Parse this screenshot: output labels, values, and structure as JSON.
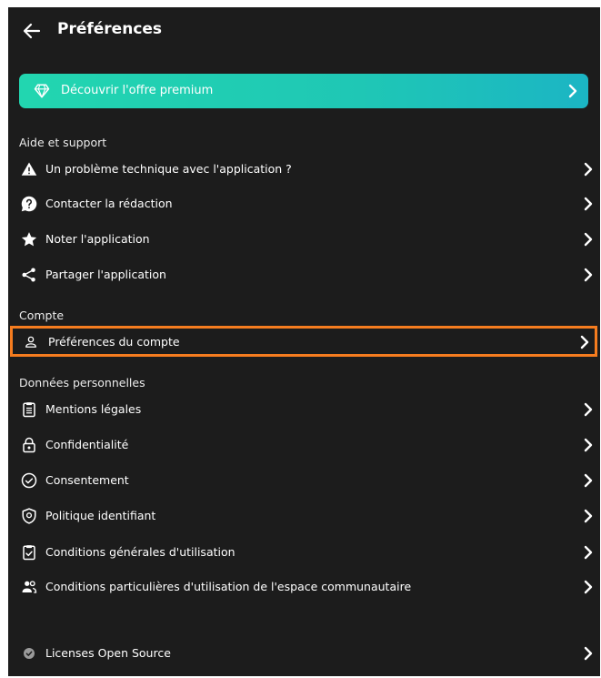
{
  "header": {
    "title": "Préférences"
  },
  "premium": {
    "label": "Découvrir l'offre premium"
  },
  "sections": {
    "aide": {
      "title": "Aide et support",
      "items": [
        {
          "label": "Un problème technique avec l'application ?",
          "icon": "warning-icon"
        },
        {
          "label": "Contacter la rédaction",
          "icon": "question-icon"
        },
        {
          "label": "Noter l'application",
          "icon": "star-icon"
        },
        {
          "label": "Partager l'application",
          "icon": "share-icon"
        }
      ]
    },
    "compte": {
      "title": "Compte",
      "items": [
        {
          "label": "Préférences du compte",
          "icon": "user-icon",
          "highlighted": true
        }
      ]
    },
    "donnees": {
      "title": "Données personnelles",
      "items": [
        {
          "label": "Mentions légales",
          "icon": "clipboard-icon"
        },
        {
          "label": "Confidentialité",
          "icon": "lock-icon"
        },
        {
          "label": "Consentement",
          "icon": "check-circle-icon"
        },
        {
          "label": "Politique identifiant",
          "icon": "shield-icon"
        },
        {
          "label": "Conditions générales d'utilisation",
          "icon": "checkbox-clipboard-icon"
        },
        {
          "label": "Conditions particulières d'utilisation de l'espace communautaire",
          "icon": "group-icon"
        }
      ]
    },
    "licenses": {
      "items": [
        {
          "label": "Licenses Open Source",
          "icon": "check-badge-icon"
        }
      ]
    }
  },
  "colors": {
    "background": "#1c1c1c",
    "premium_gradient_start": "#22d6b0",
    "premium_gradient_end": "#1bb5c4",
    "highlight_border": "#f57c1f"
  }
}
